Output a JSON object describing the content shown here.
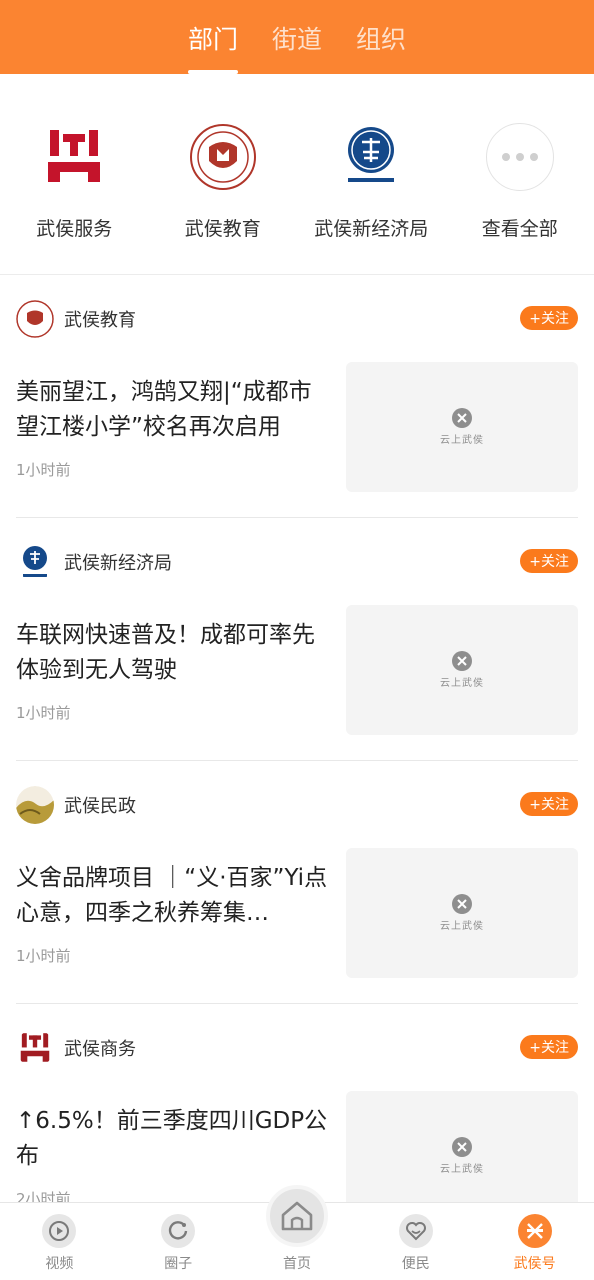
{
  "header": {
    "tabs": [
      {
        "label": "部门",
        "active": true
      },
      {
        "label": "街道",
        "active": false
      },
      {
        "label": "组织",
        "active": false
      }
    ]
  },
  "departments": [
    {
      "label": "武侯服务",
      "icon": "wuhou-service-logo"
    },
    {
      "label": "武侯教育",
      "icon": "wuhou-education-logo"
    },
    {
      "label": "武侯新经济局",
      "icon": "wuhou-new-economy-logo"
    },
    {
      "label": "查看全部",
      "icon": "more-icon"
    }
  ],
  "feed": [
    {
      "source": "武侯教育",
      "follow": "+关注",
      "title": "美丽望江，鸿鹄又翔|“成都市望江楼小学”校名再次启用",
      "time": "1小时前",
      "thumb_text": "云上武侯"
    },
    {
      "source": "武侯新经济局",
      "follow": "+关注",
      "title": "车联网快速普及！成都可率先体验到无人驾驶",
      "time": "1小时前",
      "thumb_text": "云上武侯"
    },
    {
      "source": "武侯民政",
      "follow": "+关注",
      "title": "义舍品牌项目 ｜“义·百家”Yi点心意，四季之秋养筹集…",
      "time": "1小时前",
      "thumb_text": "云上武侯"
    },
    {
      "source": "武侯商务",
      "follow": "+关注",
      "title": "↑6.5%！前三季度四川GDP公布",
      "time": "2小时前",
      "thumb_text": "云上武侯"
    }
  ],
  "bottom_nav": [
    {
      "label": "视频",
      "icon": "video-icon"
    },
    {
      "label": "圈子",
      "icon": "circle-icon"
    },
    {
      "label": "首页",
      "icon": "home-icon"
    },
    {
      "label": "便民",
      "icon": "heart-icon"
    },
    {
      "label": "武侯号",
      "icon": "wuhou-icon",
      "active": true
    }
  ],
  "colors": {
    "accent": "#fb8431",
    "follow": "#fb7a1c"
  }
}
